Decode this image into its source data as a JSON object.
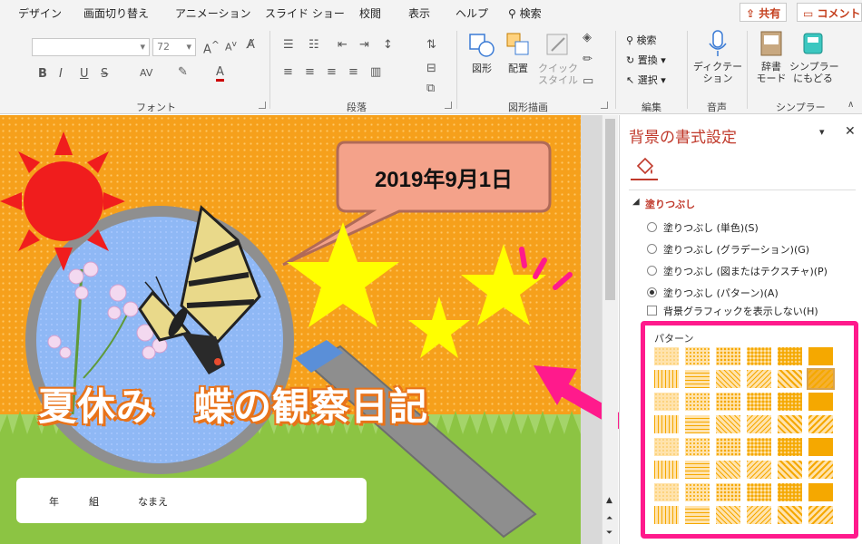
{
  "tabs": [
    "デザイン",
    "画面切り替え",
    "アニメーション",
    "スライド ショー",
    "校閲",
    "表示",
    "ヘルプ"
  ],
  "search_label": "検索",
  "share_label": "共有",
  "comment_label": "コメント",
  "font": {
    "name_value": "",
    "size_value": "72",
    "grow_label": "A",
    "shrink_label": "A",
    "bold_label": "B",
    "italic_label": "I",
    "underline_label": "U",
    "strike_label": "S",
    "spacing_label": "AV",
    "color_label": "A",
    "group_label": "フォント"
  },
  "paragraph": {
    "group_label": "段落"
  },
  "drawing": {
    "shape_label": "図形",
    "arrange_label": "配置",
    "quick_style_label": "クイック\nスタイル",
    "group_label": "図形描画"
  },
  "editing": {
    "find_label": "検索",
    "replace_label": "置換",
    "select_label": "選択",
    "group_label": "編集"
  },
  "voice": {
    "dictate_label": "ディクテー\nション",
    "group_label": "音声"
  },
  "simpler": {
    "dict_label": "辞書\nモード",
    "simpler_label": "シンプラー\nにもどる",
    "group_label": "シンプラー"
  },
  "slide": {
    "date_text": "2019年9月1日",
    "title_text": "夏休み　蝶の観察日記",
    "name_row": [
      "年",
      "組",
      "なまえ"
    ]
  },
  "pane": {
    "title": "背景の書式設定",
    "section_label": "塗りつぶし",
    "options": [
      "塗りつぶし (単色)(S)",
      "塗りつぶし (グラデーション)(G)",
      "塗りつぶし (図またはテクスチャ)(P)",
      "塗りつぶし (パターン)(A)"
    ],
    "selected_option": 3,
    "hide_graphics_label": "背景グラフィックを表示しない(H)",
    "pattern_label": "パターン"
  },
  "colors": {
    "accent_red": "#c0392b",
    "highlight_pink": "#ff1a8c",
    "slide_orange": "#f6a01b",
    "pattern_fill": "#f5a800"
  }
}
